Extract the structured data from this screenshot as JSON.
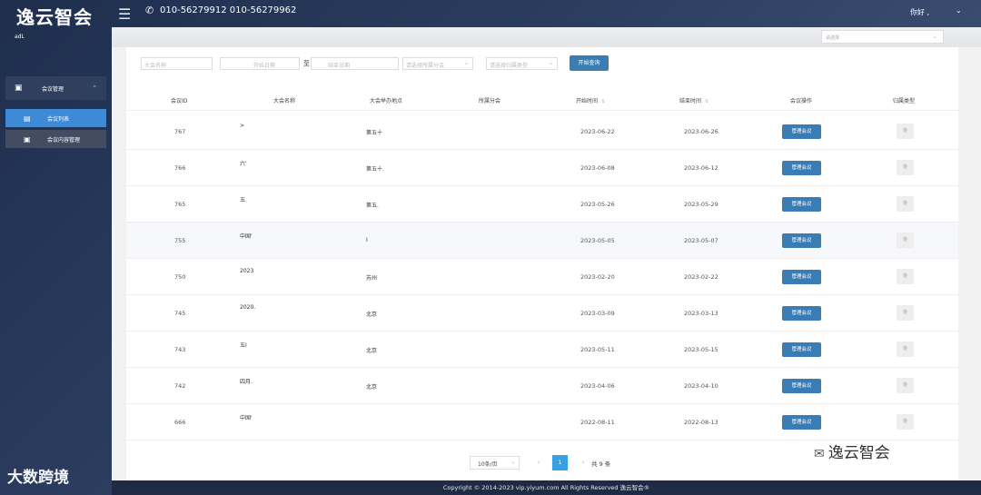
{
  "header": {
    "logo": "逸云智会",
    "menu_icon": "☰",
    "phone_icon": "✆",
    "phones": "010-56279912  010-56279962",
    "greeting": "你好 ,",
    "greeting_caret": "⌄"
  },
  "sidebar": {
    "user": "adL",
    "group": {
      "icon": "▣",
      "label": "会议管理",
      "chevron": "⌃"
    },
    "items": [
      {
        "icon": "▤",
        "label": "会议列表",
        "active": true
      },
      {
        "icon": "▣",
        "label": "会议内容管理",
        "active": false
      }
    ]
  },
  "top_select": {
    "placeholder": "请选择",
    "caret": "⌄"
  },
  "filters": {
    "name_placeholder": "大会名称",
    "date_start": "开始日期",
    "date_sep": "至",
    "date_end": "结束日期",
    "branch_placeholder": "请选择所属分会",
    "type_placeholder": "请选择归属类型",
    "caret": "⌄",
    "search_button": "开始查询"
  },
  "table": {
    "columns": [
      "会议ID",
      "大会名称",
      "大会举办地点",
      "所属分会",
      "开始时间",
      "结束时间",
      "会议操作",
      "归属类型"
    ],
    "sort_icon": "⇅",
    "rows": [
      {
        "id": "767",
        "name": ">",
        "location": "第五十",
        "start": "2023-06-22",
        "end": "2023-06-26",
        "action": "管理会议",
        "type": "协"
      },
      {
        "id": "766",
        "name": "六'",
        "location": "第五十.",
        "start": "2023-06-08",
        "end": "2023-06-12",
        "action": "管理会议",
        "type": "协"
      },
      {
        "id": "765",
        "name": "五.",
        "location": "第五.",
        "start": "2023-05-26",
        "end": "2023-05-29",
        "action": "管理会议",
        "type": "协"
      },
      {
        "id": "755",
        "name": "中国'",
        "location": "I",
        "start": "2023-05-05",
        "end": "2023-05-07",
        "action": "管理会议",
        "type": "协"
      },
      {
        "id": "750",
        "name": "2023",
        "location": "苏州",
        "start": "2023-02-20",
        "end": "2023-02-22",
        "action": "管理会议",
        "type": "协"
      },
      {
        "id": "745",
        "name": "2020.",
        "location": "北京",
        "start": "2023-03-09",
        "end": "2023-03-13",
        "action": "管理会议",
        "type": "协"
      },
      {
        "id": "743",
        "name": "五Ⅰ",
        "location": "北京",
        "start": "2023-05-11",
        "end": "2023-05-15",
        "action": "管理会议",
        "type": "协"
      },
      {
        "id": "742",
        "name": "四月.",
        "location": "北京",
        "start": "2023-04-06",
        "end": "2023-04-10",
        "action": "管理会议",
        "type": "协"
      },
      {
        "id": "666",
        "name": "中国'",
        "location": "",
        "start": "2022-08-11",
        "end": "2022-08-13",
        "action": "管理会议",
        "type": "协"
      }
    ]
  },
  "pagination": {
    "page_size": "10条/页",
    "caret": "⌄",
    "prev": "‹",
    "current": "1",
    "next": "›",
    "total": "共 9 条"
  },
  "footer": {
    "copyright": "Copyright © 2014-2023 vip.yiyum.com All Rights Reserved  逸云智会®"
  },
  "watermarks": {
    "left": "大数跨境",
    "right": "逸云智会",
    "right_icon": "✉"
  }
}
